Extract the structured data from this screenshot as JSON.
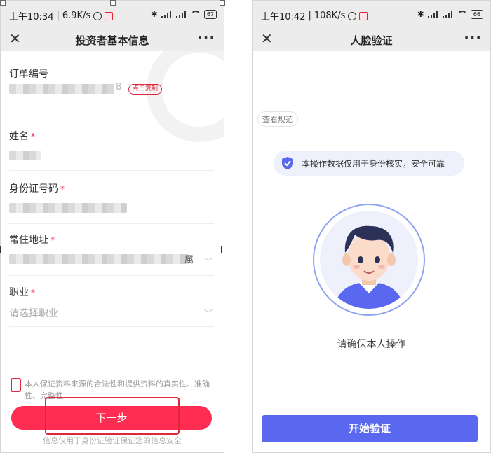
{
  "left": {
    "status": {
      "time": "上午10:34",
      "speed": "6.9K/s",
      "battery": "67"
    },
    "nav": {
      "close": "✕",
      "title": "投资者基本信息",
      "more": "···"
    },
    "order": {
      "label": "订单编号",
      "value_end": "8",
      "copy_badge": "点击复制"
    },
    "name": {
      "label": "姓名",
      "required": "*"
    },
    "id_number": {
      "label": "身份证号码",
      "required": "*"
    },
    "address": {
      "label": "常住地址",
      "required": "*",
      "value_end": "属"
    },
    "occupation": {
      "label": "职业",
      "required": "*",
      "placeholder": "请选择职业"
    },
    "agreement": {
      "text": "本人保证资料来源的合法性和提供资料的真实性、准确性、完整性"
    },
    "next_button": "下一步",
    "footer": "信息仅用于身份证验证保证您的信息安全"
  },
  "right": {
    "status": {
      "time": "上午10:42",
      "speed": "108K/s",
      "battery": "66"
    },
    "nav": {
      "close": "✕",
      "title": "人脸验证",
      "more": "···"
    },
    "spec_link": "查看规范",
    "notice": "本操作数据仅用于身份核实，安全可靠",
    "confirm": "请确保本人操作",
    "start_button": "开始验证"
  },
  "colors": {
    "accent_red": "#ff2d52",
    "accent_blue": "#5a68f0",
    "notice_bg": "#eef1fb"
  }
}
